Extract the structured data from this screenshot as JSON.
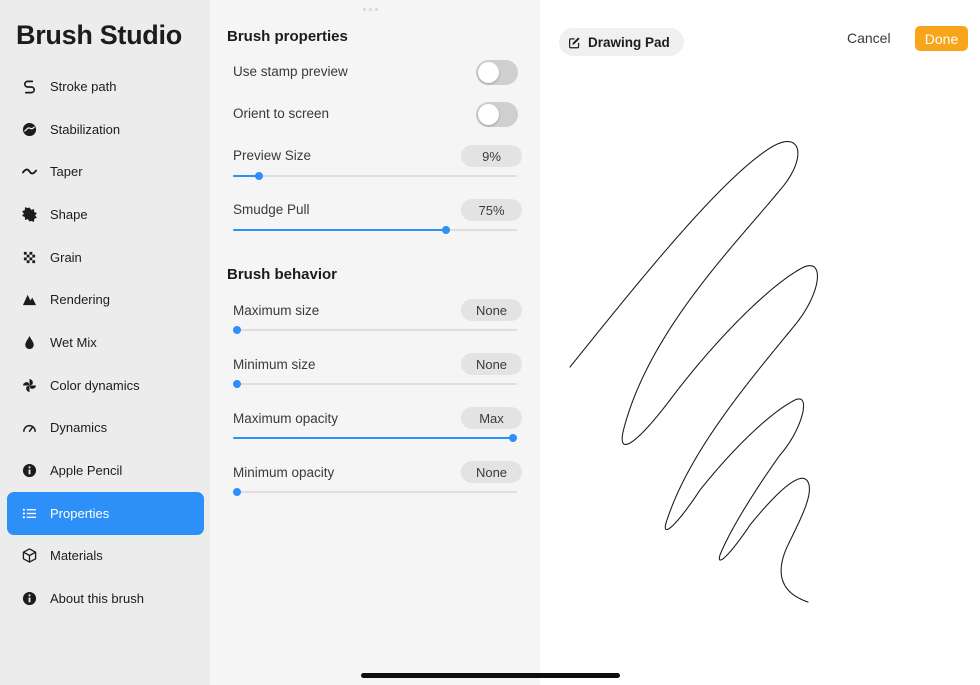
{
  "sidebar": {
    "title": "Brush Studio",
    "items": [
      {
        "label": "Stroke path",
        "icon": "stroke-path-icon"
      },
      {
        "label": "Stabilization",
        "icon": "stabilization-icon"
      },
      {
        "label": "Taper",
        "icon": "taper-icon"
      },
      {
        "label": "Shape",
        "icon": "shape-icon"
      },
      {
        "label": "Grain",
        "icon": "grain-icon"
      },
      {
        "label": "Rendering",
        "icon": "rendering-icon"
      },
      {
        "label": "Wet Mix",
        "icon": "wet-mix-icon"
      },
      {
        "label": "Color dynamics",
        "icon": "color-dynamics-icon"
      },
      {
        "label": "Dynamics",
        "icon": "dynamics-icon"
      },
      {
        "label": "Apple Pencil",
        "icon": "apple-pencil-icon"
      },
      {
        "label": "Properties",
        "icon": "properties-icon",
        "active": true
      },
      {
        "label": "Materials",
        "icon": "materials-icon"
      },
      {
        "label": "About this brush",
        "icon": "info-icon"
      }
    ]
  },
  "properties": {
    "brush_properties_title": "Brush properties",
    "use_stamp_preview": {
      "label": "Use stamp preview",
      "on": false
    },
    "orient_to_screen": {
      "label": "Orient to screen",
      "on": false
    },
    "preview_size": {
      "label": "Preview Size",
      "value": "9%",
      "fraction": 0.09
    },
    "smudge_pull": {
      "label": "Smudge Pull",
      "value": "75%",
      "fraction": 0.75
    },
    "brush_behavior_title": "Brush behavior",
    "maximum_size": {
      "label": "Maximum size",
      "value": "None",
      "fraction": 0.0
    },
    "minimum_size": {
      "label": "Minimum size",
      "value": "None",
      "fraction": 0.0
    },
    "maximum_opacity": {
      "label": "Maximum opacity",
      "value": "Max",
      "fraction": 1.0
    },
    "minimum_opacity": {
      "label": "Minimum opacity",
      "value": "None",
      "fraction": 0.0
    }
  },
  "drawing_pad": {
    "label": "Drawing Pad",
    "icon": "edit-icon",
    "cancel_label": "Cancel",
    "done_label": "Done"
  },
  "colors": {
    "accent": "#2d8ff8",
    "done": "#f9a51b"
  }
}
